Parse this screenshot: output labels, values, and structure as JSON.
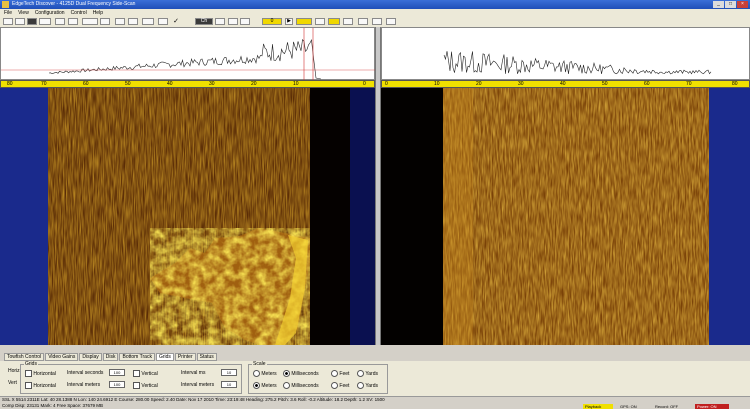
{
  "window": {
    "title": "EdgeTech Discover - 4125D Dual Frequency Side-Scan"
  },
  "menu": [
    "File",
    "View",
    "Configuration",
    "Control",
    "Help"
  ],
  "toolbar": {
    "channel": "Ch",
    "freq": "0"
  },
  "scale_left": [
    "80",
    "70",
    "60",
    "50",
    "40",
    "30",
    "20",
    "10",
    "0"
  ],
  "scale_right": [
    "0",
    "10",
    "20",
    "30",
    "40",
    "50",
    "60",
    "70",
    "80"
  ],
  "tabs": [
    "Towfish Control",
    "Video Gains",
    "Display",
    "Disk",
    "Bottom Track",
    "Grids",
    "Printer",
    "Status"
  ],
  "grids": {
    "group": "Grids",
    "horiz_label": "Horiz",
    "vert_label": "Vert",
    "horizontal": "Horizontal",
    "interval_seconds": "Interval seconds",
    "interval_seconds_value": "100",
    "vertical": "Vertical",
    "interval_ms": "Interval ms",
    "interval_ms_value": "10",
    "interval_meters": "Interval meters",
    "interval_meters_value": "100",
    "interval_meters2": "Interval meters",
    "interval_meters2_value": "10"
  },
  "scale": {
    "group": "Scale",
    "meters": "Meters",
    "milliseconds": "Milliseconds",
    "feet": "Feet",
    "yards": "Yards",
    "selected": "Milliseconds"
  },
  "status": {
    "line1": "SSL X 5514 2311E  Lat: 40 28.1388 N  Lon: 140 24.6912 E  Course: 280.00  Speed: 2.40  Date: Nov 17 2010  Time: 23:19:48  Heading: 275.2  Pitch: 3.6  Roll: -0.2  Altitude: 18.2  Depth: 1.2  SV: 1500",
    "line2": "Comp Disp: 23131  Mark: 4  Free Space: 37679 MB",
    "ind_playback": "Playback",
    "ind_gps": "GPS: ON",
    "ind_record": "Record: OFF",
    "ind_power": "Power: ON"
  },
  "colors": {
    "sonar_dark": "#1a0a00",
    "sonar_bright": "#f0c020",
    "water_column": "#000000",
    "out_of_range": "#1a2a8c"
  }
}
